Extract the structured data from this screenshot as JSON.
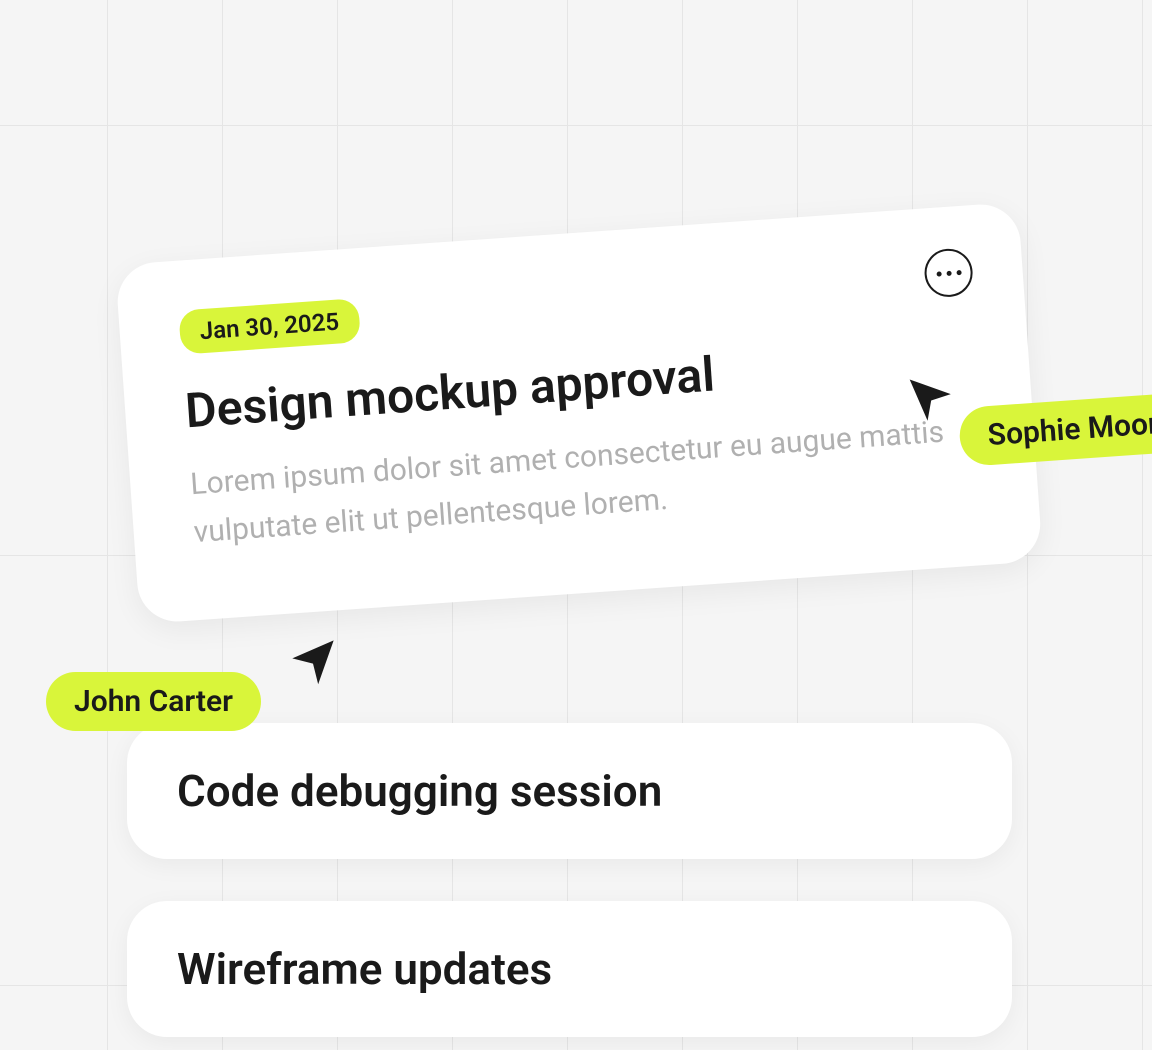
{
  "cards": {
    "main": {
      "date": "Jan 30, 2025",
      "title": "Design mockup approval",
      "description": "Lorem ipsum dolor sit amet consectetur eu augue mattis vulputate elit ut pellentesque lorem."
    },
    "secondary": [
      {
        "title": "Code debugging session"
      },
      {
        "title": "Wireframe updates"
      }
    ]
  },
  "cursors": {
    "user1": "Sophie Moore",
    "user2": "John Carter"
  },
  "colors": {
    "accent": "#d9f53a"
  }
}
